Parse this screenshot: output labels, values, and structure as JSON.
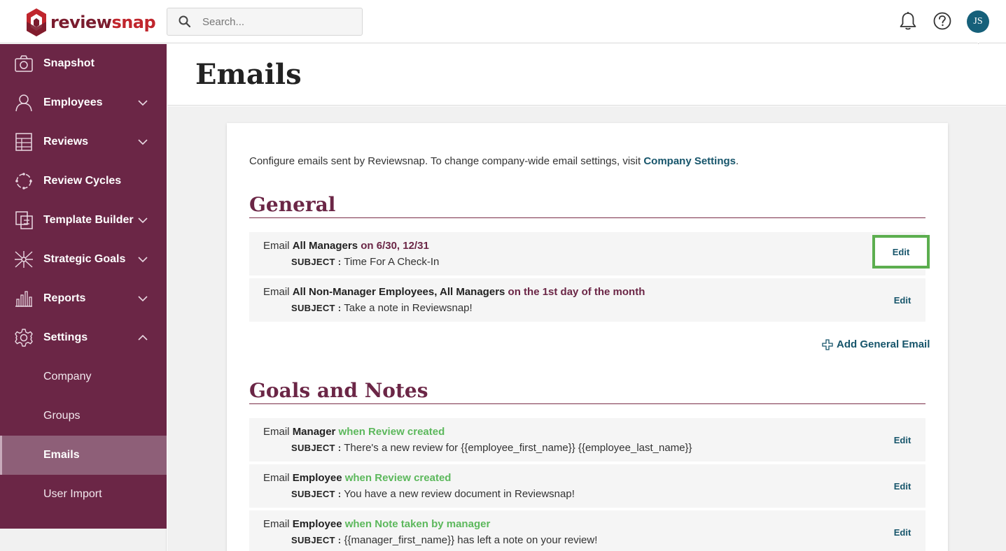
{
  "app": {
    "logo_part1": "review",
    "logo_part2": "snap"
  },
  "search": {
    "placeholder": "Search..."
  },
  "header": {
    "avatar_initials": "JS"
  },
  "sidebar": {
    "items": [
      {
        "label": "Snapshot",
        "icon": "camera-icon"
      },
      {
        "label": "Employees",
        "icon": "person-icon",
        "expanded": false
      },
      {
        "label": "Reviews",
        "icon": "document-icon",
        "expanded": false
      },
      {
        "label": "Review Cycles",
        "icon": "cycle-icon"
      },
      {
        "label": "Template Builder",
        "icon": "template-icon",
        "expanded": false
      },
      {
        "label": "Strategic Goals",
        "icon": "goals-icon",
        "expanded": false
      },
      {
        "label": "Reports",
        "icon": "bar-chart-icon",
        "expanded": false
      },
      {
        "label": "Settings",
        "icon": "gear-icon",
        "expanded": true
      }
    ],
    "settings_sub": [
      {
        "label": "Company"
      },
      {
        "label": "Groups"
      },
      {
        "label": "Emails",
        "active": true
      },
      {
        "label": "User Import"
      }
    ]
  },
  "page": {
    "title": "Emails",
    "intro_text": "Configure emails sent by Reviewsnap. To change company-wide email settings, visit ",
    "intro_link": "Company Settings",
    "intro_end": "."
  },
  "general": {
    "heading": "General",
    "rows": [
      {
        "prefix": "Email ",
        "who": "All Managers",
        "when": " on 6/30, 12/31",
        "subject_label": "SUBJECT :",
        "subject": " Time For A Check-In",
        "edit": "Edit"
      },
      {
        "prefix": "Email ",
        "who": "All Non-Manager Employees, All Managers",
        "when": " on the 1st day of the month",
        "subject_label": "SUBJECT :",
        "subject": " Take a note in Reviewsnap!",
        "edit": "Edit"
      }
    ],
    "add_label": "Add General Email"
  },
  "goals_notes": {
    "heading": "Goals and Notes",
    "rows": [
      {
        "prefix": "Email ",
        "who": "Manager",
        "when": " when Review created",
        "subject_label": "SUBJECT :",
        "subject": " There's a new review for {{employee_first_name}} {{employee_last_name}}",
        "edit": "Edit"
      },
      {
        "prefix": "Email ",
        "who": "Employee",
        "when": " when Review created",
        "subject_label": "SUBJECT :",
        "subject": " You have a new review document in Reviewsnap!",
        "edit": "Edit"
      },
      {
        "prefix": "Email ",
        "who": "Employee",
        "when": " when Note taken by manager",
        "subject_label": "SUBJECT :",
        "subject": " {{manager_first_name}} has left a note on your review!",
        "edit": "Edit"
      }
    ]
  },
  "colors": {
    "sidebar_bg": "#6b2646",
    "active_item_bg": "#8e5f78",
    "link": "#17556b",
    "manager_when": "#6b2646",
    "trigger_when": "#5cb85c",
    "highlight_border": "#5cae4f",
    "avatar_bg": "#16607a"
  }
}
